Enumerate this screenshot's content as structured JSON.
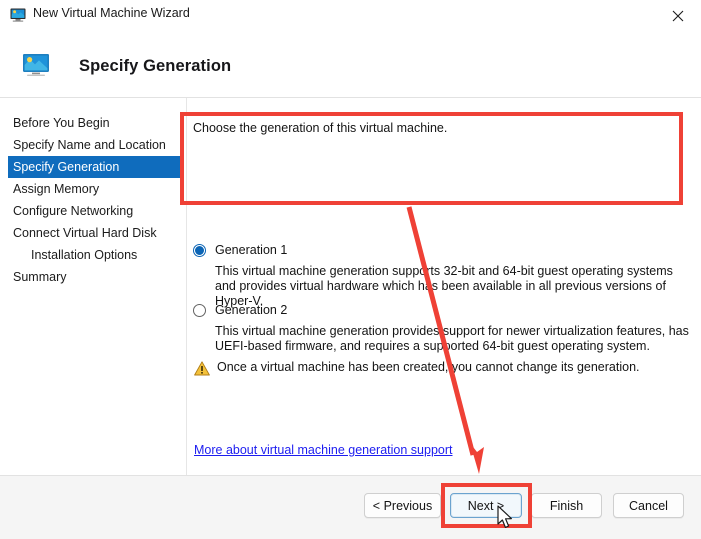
{
  "window": {
    "title": "New Virtual Machine Wizard",
    "icon": "virtual-machine-icon",
    "close_label": "×"
  },
  "header": {
    "title": "Specify Generation",
    "icon": "virtual-machine-icon"
  },
  "sidebar": {
    "items": [
      {
        "label": "Before You Begin",
        "selected": false,
        "indented": false
      },
      {
        "label": "Specify Name and Location",
        "selected": false,
        "indented": false
      },
      {
        "label": "Specify Generation",
        "selected": true,
        "indented": false
      },
      {
        "label": "Assign Memory",
        "selected": false,
        "indented": false
      },
      {
        "label": "Configure Networking",
        "selected": false,
        "indented": false
      },
      {
        "label": "Connect Virtual Hard Disk",
        "selected": false,
        "indented": false
      },
      {
        "label": "Installation Options",
        "selected": false,
        "indented": true
      },
      {
        "label": "Summary",
        "selected": false,
        "indented": false
      }
    ]
  },
  "main": {
    "intro": "Choose the generation of this virtual machine.",
    "options": [
      {
        "label": "Generation 1",
        "checked": true,
        "description": "This virtual machine generation supports 32-bit and 64-bit guest operating systems and provides virtual hardware which has been available in all previous versions of Hyper-V."
      },
      {
        "label": "Generation 2",
        "checked": false,
        "description": "This virtual machine generation provides support for newer virtualization features, has UEFI-based firmware, and requires a supported 64-bit guest operating system."
      }
    ],
    "warning": {
      "icon": "warning-triangle-icon",
      "text": "Once a virtual machine has been created, you cannot change its generation."
    },
    "link": "More about virtual machine generation support"
  },
  "footer": {
    "buttons": [
      {
        "label": "< Previous",
        "primary": false
      },
      {
        "label": "Next >",
        "primary": true
      },
      {
        "label": "Finish",
        "primary": false
      },
      {
        "label": "Cancel",
        "primary": false
      }
    ]
  },
  "annotations": {
    "highlight_color": "#ef4136",
    "boxes": [
      {
        "name": "generation-1-option-highlight"
      },
      {
        "name": "next-button-highlight"
      }
    ],
    "arrow": {
      "name": "pointer-arrow",
      "from": "generation-1-option",
      "to": "next-button"
    }
  },
  "colors": {
    "accent": "#0f6cbd",
    "radio_accent": "#0b64b5",
    "annotation": "#ef4136",
    "link": "#1d1df0",
    "warning": "#f0a30a"
  }
}
